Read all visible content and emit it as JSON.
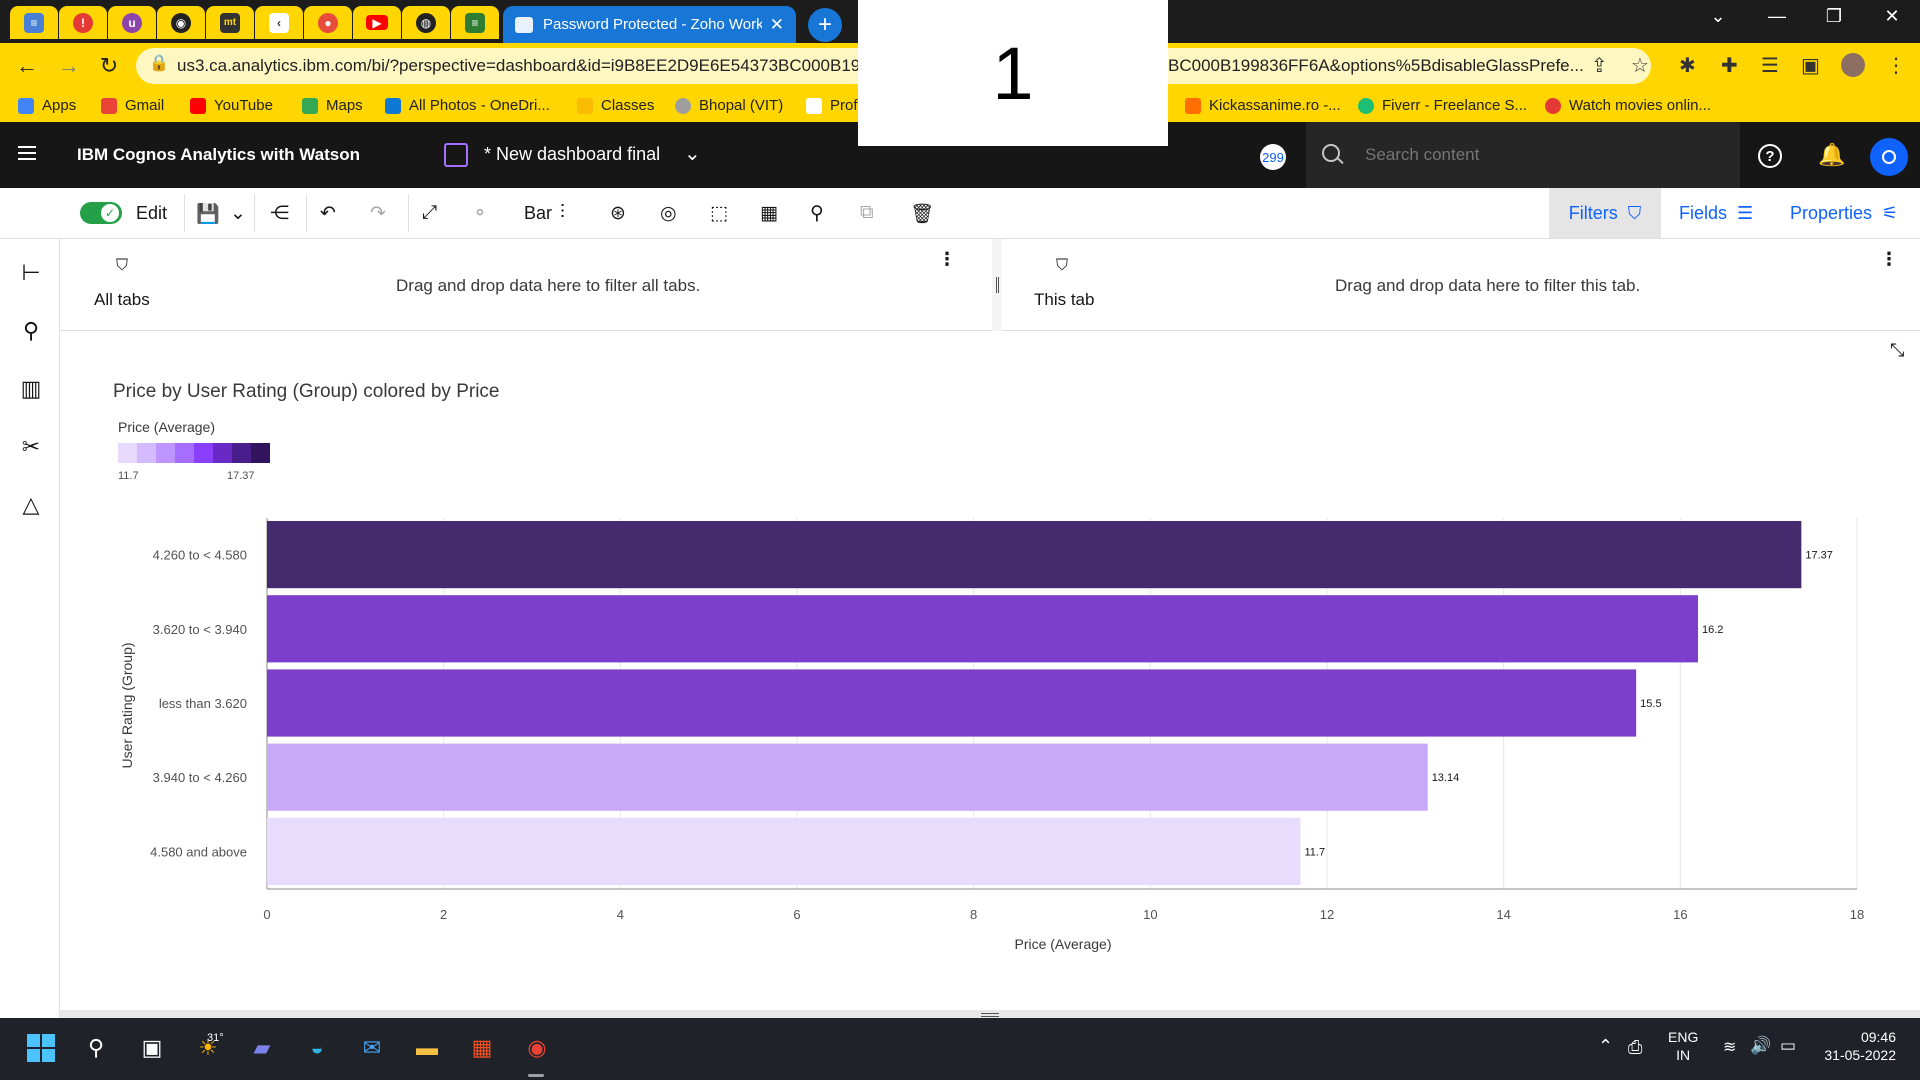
{
  "browser": {
    "active_tab_title": "Password Protected - Zoho Work",
    "tab_favicons": [
      "docs-icon",
      "alert-icon",
      "u-icon",
      "github-icon",
      "mt-icon",
      "arrow-icon",
      "circle-icon",
      "youtube-icon",
      "globe-icon",
      "cognos-icon"
    ],
    "url_left": "us3.ca.analytics.ibm.com/bi/?perspective=dashboard&id=i9B8EE2D9E6E54373BC000B19",
    "url_right": "BC000B199836FF6A&options%5BdisableGlassPrefe...",
    "bookmarks": [
      "Apps",
      "Gmail",
      "YouTube",
      "Maps",
      "All Photos - OneDri...",
      "Classes",
      "Bhopal (VIT)",
      "Prof",
      "Kickassanime.ro -...",
      "Fiverr - Freelance S...",
      "Watch movies onlin..."
    ]
  },
  "overlay": {
    "number": "1"
  },
  "header": {
    "app_title": "IBM Cognos Analytics with Watson",
    "dashboard_title": "* New dashboard final",
    "notification_count": "299",
    "search_placeholder": "Search content"
  },
  "toolbar": {
    "edit_label": "Edit",
    "visualization_label": "Bar",
    "filters_label": "Filters",
    "fields_label": "Fields",
    "properties_label": "Properties"
  },
  "filters": {
    "all_tabs_label": "All tabs",
    "all_tabs_hint": "Drag and drop data here to filter all tabs.",
    "this_tab_label": "This tab",
    "this_tab_hint": "Drag and drop data here to filter this tab."
  },
  "legend": {
    "title": "Price (Average)",
    "min_label": "11.7",
    "max_label": "17.37",
    "colors": [
      "#e8daff",
      "#d4bbff",
      "#be95ff",
      "#a56eff",
      "#8a3ffc",
      "#6929c4",
      "#491d8b",
      "#31135e"
    ]
  },
  "chart_data": {
    "type": "bar",
    "orientation": "horizontal",
    "title": "Price by User Rating (Group) colored by Price",
    "xlabel": "Price (Average)",
    "ylabel": "User Rating (Group)",
    "categories": [
      "4.260 to < 4.580",
      "3.620 to < 3.940",
      "less than 3.620",
      "3.940 to < 4.260",
      "4.580 and above"
    ],
    "values": [
      17.37,
      16.2,
      15.5,
      13.14,
      11.7
    ],
    "value_labels": [
      "17.37",
      "16.2",
      "15.5",
      "13.14",
      "11.7"
    ],
    "bar_colors": [
      "#452a6e",
      "#7c3fcc",
      "#7c3fcc",
      "#c8a9f7",
      "#e7dcfb"
    ],
    "xlim": [
      0,
      18
    ],
    "xticks": [
      0,
      2,
      4,
      6,
      8,
      10,
      12,
      14,
      16,
      18
    ],
    "grid": true,
    "legend_position": "top-left"
  },
  "taskbar": {
    "weather_temp": "31°",
    "lang_top": "ENG",
    "lang_bottom": "IN",
    "time": "09:46",
    "date": "31-05-2022"
  }
}
